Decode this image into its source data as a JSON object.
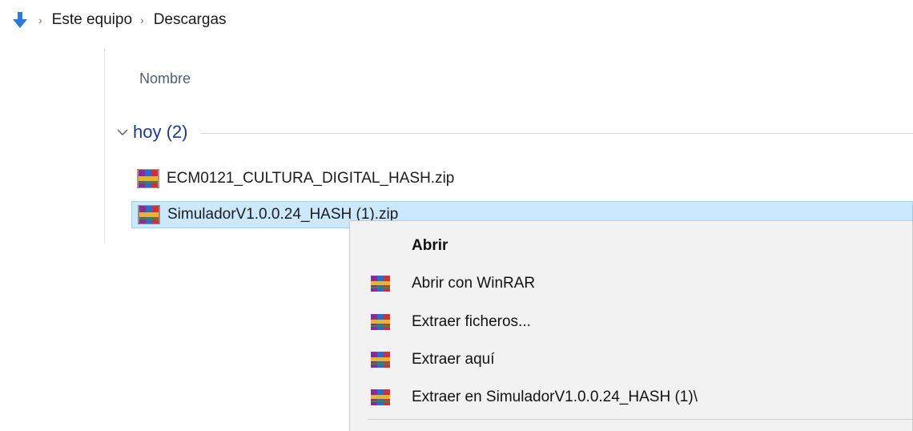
{
  "breadcrumb": {
    "items": [
      "Este equipo",
      "Descargas"
    ],
    "separator": "›"
  },
  "columns": {
    "name": "Nombre"
  },
  "group": {
    "label": "hoy (2)"
  },
  "files": [
    {
      "name": "ECM0121_CULTURA_DIGITAL_HASH.zip",
      "icon": "winrar-archive-icon",
      "selected": false
    },
    {
      "name": "SimuladorV1.0.0.24_HASH (1).zip",
      "icon": "winrar-archive-icon",
      "selected": true
    }
  ],
  "context_menu": {
    "items": [
      {
        "label": "Abrir",
        "bold": true,
        "icon": ""
      },
      {
        "label": "Abrir con WinRAR",
        "bold": false,
        "icon": "winrar-icon"
      },
      {
        "label": "Extraer ficheros...",
        "bold": false,
        "icon": "winrar-icon"
      },
      {
        "label": "Extraer aquí",
        "bold": false,
        "icon": "winrar-icon"
      },
      {
        "label": "Extraer en SimuladorV1.0.0.24_HASH (1)\\",
        "bold": false,
        "icon": "winrar-icon"
      }
    ]
  },
  "colors": {
    "selection_bg": "#cce8ff",
    "selection_border": "#99d1ff",
    "group_label": "#1a3a8e",
    "menu_bg": "#f2f2f2",
    "download_arrow": "#2b7bd6"
  }
}
